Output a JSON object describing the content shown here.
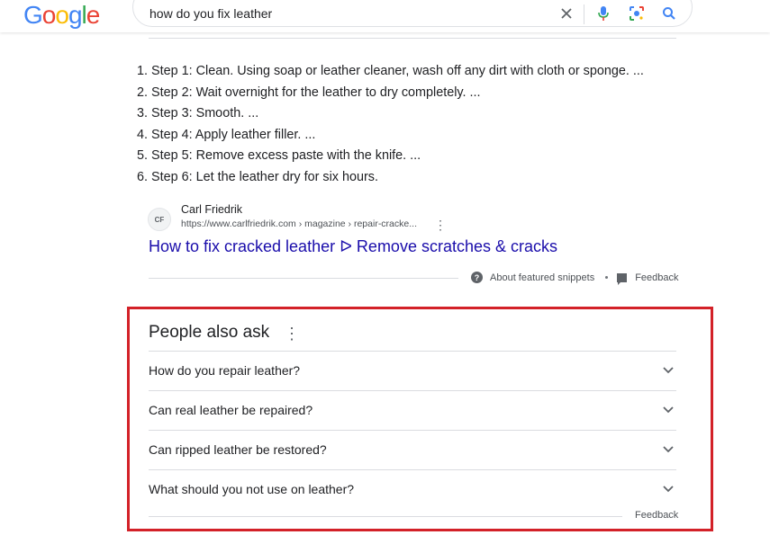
{
  "header": {
    "logo_letters": [
      {
        "char": "G",
        "color": "#4285F4"
      },
      {
        "char": "o",
        "color": "#EA4335"
      },
      {
        "char": "o",
        "color": "#FBBC05"
      },
      {
        "char": "g",
        "color": "#4285F4"
      },
      {
        "char": "l",
        "color": "#34A853"
      },
      {
        "char": "e",
        "color": "#EA4335"
      }
    ],
    "search": {
      "value": "how do you fix leather",
      "icons": [
        "close-icon",
        "microphone-icon",
        "camera-lens-icon",
        "search-icon"
      ]
    }
  },
  "snippet": {
    "steps": [
      "Step 1: Clean. Using soap or leather cleaner, wash off any dirt with cloth or sponge. ...",
      "Step 2: Wait overnight for the leather to dry completely. ...",
      "Step 3: Smooth. ...",
      "Step 4: Apply leather filler. ...",
      "Step 5: Remove excess paste with the knife. ...",
      "Step 6: Let the leather dry for six hours."
    ],
    "source": {
      "favicon_text": "CF",
      "site_name": "Carl Friedrik",
      "url": "https://www.carlfriedrik.com › magazine › repair-cracke...",
      "title": "How to fix cracked leather ᐅ Remove scratches & cracks"
    },
    "footer": {
      "about": "About featured snippets",
      "feedback": "Feedback"
    }
  },
  "paa": {
    "title": "People also ask",
    "questions": [
      "How do you repair leather?",
      "Can real leather be repaired?",
      "Can ripped leather be restored?",
      "What should you not use on leather?"
    ],
    "feedback": "Feedback",
    "highlight_color": "#d32128"
  }
}
